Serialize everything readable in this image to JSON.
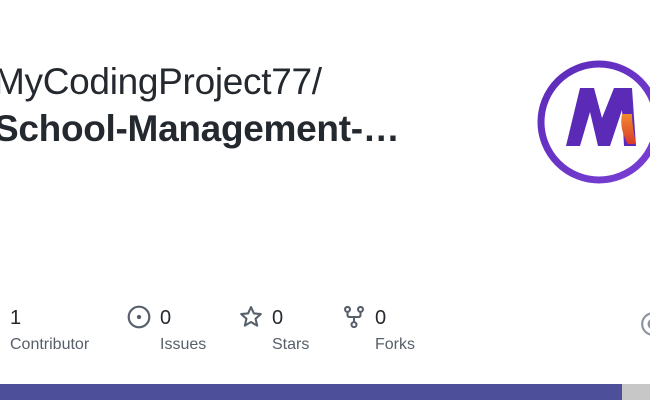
{
  "repo": {
    "owner_prefix": "MyCodingProject77/",
    "name": "School-Management-…"
  },
  "avatar": {
    "letter": "M",
    "accent": "#6a2fc4",
    "flame": "#e8552a"
  },
  "stats": [
    {
      "value": "1",
      "label": "Contributor",
      "icon": "people-icon"
    },
    {
      "value": "0",
      "label": "Issues",
      "icon": "issue-opened-icon"
    },
    {
      "value": "0",
      "label": "Stars",
      "icon": "star-icon"
    },
    {
      "value": "0",
      "label": "Forks",
      "icon": "repo-forked-icon"
    }
  ],
  "language_bar": {
    "primary_color": "#4e4f9a",
    "secondary_color": "#c7c7c7"
  }
}
